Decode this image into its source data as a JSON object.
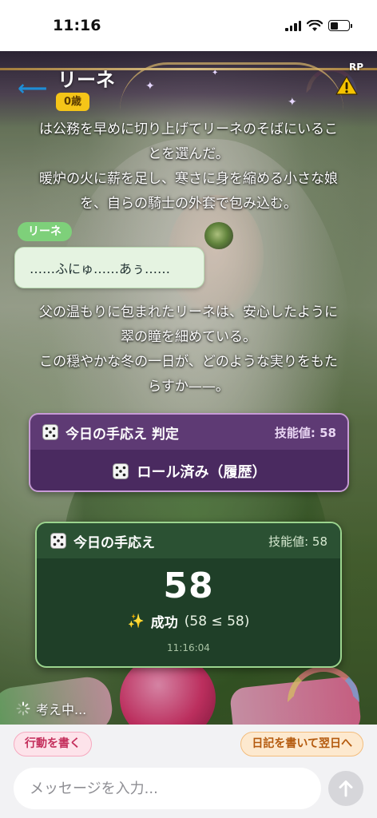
{
  "status_bar": {
    "time": "11:16"
  },
  "header": {
    "character_name": "リーネ",
    "age_badge": "0歳",
    "rp_label": "RP",
    "warning_icon": "warning-icon",
    "back_icon": "back-arrow-icon"
  },
  "chat": {
    "narration_1": [
      "は公務を早めに切り上げてリーネのそばにいるこ",
      "とを選んだ。",
      "暖炉の火に薪を足し、寒さに身を縮める小さな娘",
      "を、自らの騎士の外套で包み込む。"
    ],
    "speaker": "リーネ",
    "speech": "……ふにゅ……あぅ……",
    "narration_2": [
      "父の温もりに包まれたリーネは、安心したように",
      "翠の瞳を細めている。",
      "この穏やかな冬の一日が、どのような実りをもた",
      "らすか——。"
    ]
  },
  "roll_card": {
    "title": "今日の手応え 判定",
    "skill_value": "技能値: 58",
    "status": "ロール済み（履歴）",
    "icon": "dice-icon"
  },
  "result_card": {
    "title": "今日の手応え",
    "skill_value": "技能値: 58",
    "value": "58",
    "outcome": "成功",
    "outcome_detail": "(58 ≤ 58)",
    "timestamp": "11:16:04",
    "icon": "sparkles-icon"
  },
  "thinking": {
    "text": "考え中..."
  },
  "bottom": {
    "action_button": "行動を書く",
    "diary_button": "日記を書いて翌日へ",
    "input_placeholder": "メッセージを入力...",
    "send_icon": "arrow-up-icon"
  },
  "colors": {
    "roll_header": "#5e3a74",
    "result_bg": "#1f3f28",
    "age_badge": "#f5c518",
    "speaker_tag": "#7ed07a"
  }
}
